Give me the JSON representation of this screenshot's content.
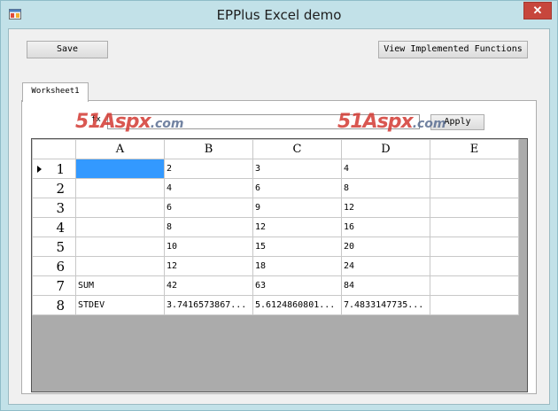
{
  "window": {
    "title": "EPPlus Excel demo",
    "close_glyph": "✕",
    "app_icon": "window-app-icon",
    "accent": "#c2e1e8",
    "close_color": "#c7463c"
  },
  "toolbar": {
    "save_label": "Save",
    "view_functions_label": "View Implemented Functions"
  },
  "tabs": [
    {
      "label": "Worksheet1",
      "active": true
    }
  ],
  "formula_bar": {
    "fx_label": "fx",
    "value": "",
    "apply_label": "Apply"
  },
  "watermark": {
    "text": "51Aspx",
    "suffix": ".com"
  },
  "grid": {
    "columns": [
      "A",
      "B",
      "C",
      "D",
      "E"
    ],
    "rows": [
      {
        "num": "1",
        "cells": [
          "",
          "2",
          "3",
          "4",
          ""
        ],
        "current": true
      },
      {
        "num": "2",
        "cells": [
          "",
          "4",
          "6",
          "8",
          ""
        ]
      },
      {
        "num": "3",
        "cells": [
          "",
          "6",
          "9",
          "12",
          ""
        ]
      },
      {
        "num": "4",
        "cells": [
          "",
          "8",
          "12",
          "16",
          ""
        ]
      },
      {
        "num": "5",
        "cells": [
          "",
          "10",
          "15",
          "20",
          ""
        ]
      },
      {
        "num": "6",
        "cells": [
          "",
          "12",
          "18",
          "24",
          ""
        ]
      },
      {
        "num": "7",
        "cells": [
          "SUM",
          "42",
          "63",
          "84",
          ""
        ]
      },
      {
        "num": "8",
        "cells": [
          "STDEV",
          "3.7416573867...",
          "5.6124860801...",
          "7.4833147735...",
          ""
        ]
      }
    ],
    "selected_cell": {
      "row": 0,
      "col": 0
    },
    "selection_color": "#3399ff",
    "empty_area_color": "#ababab"
  }
}
